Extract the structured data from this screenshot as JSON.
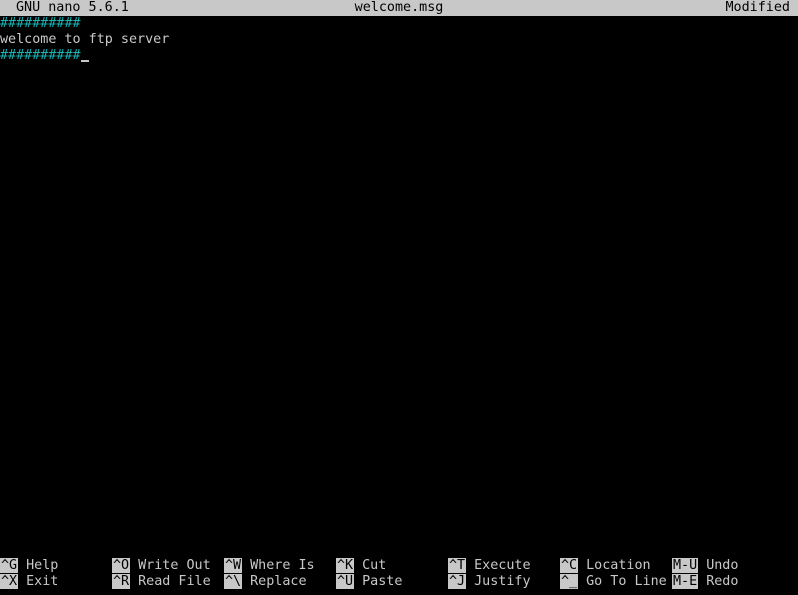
{
  "titlebar": {
    "app": "GNU nano 5.6.1",
    "filename": "welcome.msg",
    "status": "Modified"
  },
  "editor": {
    "lines": [
      "##########",
      "welcome to ftp server",
      "##########"
    ]
  },
  "shortcuts": {
    "row1": [
      {
        "key": "^G",
        "label": "Help"
      },
      {
        "key": "^O",
        "label": "Write Out"
      },
      {
        "key": "^W",
        "label": "Where Is"
      },
      {
        "key": "^K",
        "label": "Cut"
      },
      {
        "key": "^T",
        "label": "Execute"
      },
      {
        "key": "^C",
        "label": "Location"
      },
      {
        "key": "M-U",
        "label": "Undo"
      }
    ],
    "row2": [
      {
        "key": "^X",
        "label": "Exit"
      },
      {
        "key": "^R",
        "label": "Read File"
      },
      {
        "key": "^\\",
        "label": "Replace"
      },
      {
        "key": "^U",
        "label": "Paste"
      },
      {
        "key": "^J",
        "label": "Justify"
      },
      {
        "key": "^_",
        "label": "Go To Line"
      },
      {
        "key": "M-E",
        "label": "Redo"
      }
    ]
  },
  "colors": {
    "background": "#000000",
    "foreground": "#c8c8c8",
    "hash_line": "#18b2b2",
    "titlebar_bg": "#c8c8c8"
  }
}
